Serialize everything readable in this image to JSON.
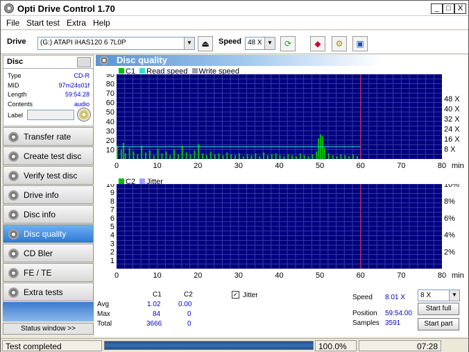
{
  "window": {
    "title": "Opti Drive Control 1.70",
    "min": "_",
    "max": "□",
    "close": "X"
  },
  "menu": [
    "File",
    "Start test",
    "Extra",
    "Help"
  ],
  "toolbar": {
    "drive_label": "Drive",
    "drive_value": "(G:)   ATAPI iHAS120   6 7L0P",
    "speed_label": "Speed",
    "speed_value": "48 X"
  },
  "disc": {
    "header": "Disc",
    "rows": [
      {
        "k": "Type",
        "v": "CD-R"
      },
      {
        "k": "MID",
        "v": "97m24s01f"
      },
      {
        "k": "Length",
        "v": "59:54.28"
      },
      {
        "k": "Contents",
        "v": "audio"
      },
      {
        "k": "Label",
        "v": ""
      }
    ]
  },
  "nav": [
    "Transfer rate",
    "Create test disc",
    "Verify test disc",
    "Drive info",
    "Disc info",
    "Disc quality",
    "CD Bler",
    "FE / TE",
    "Extra tests"
  ],
  "nav_active": 5,
  "status_window": "Status window >>",
  "panel_title": "Disc quality",
  "chart_data": [
    {
      "type": "bar",
      "legend": [
        "C1",
        "Read speed",
        "Write speed"
      ],
      "colors": {
        "c1": "#00c000",
        "read": "#30e0d0",
        "write": "#a0a0a0",
        "bg": "#000080",
        "grid": "#3a3aa0",
        "marker": "#b03060"
      },
      "x_ticks": [
        0,
        10,
        20,
        30,
        40,
        50,
        60,
        70,
        80
      ],
      "x_unit": "min",
      "y_ticks": [
        10,
        20,
        30,
        40,
        50,
        60,
        70,
        80,
        90
      ],
      "y2_ticks": [
        "8 X",
        "16 X",
        "24 X",
        "32 X",
        "40 X",
        "48 X"
      ],
      "xlim": [
        0,
        80
      ],
      "ylim": [
        0,
        90
      ],
      "end_marker": 60,
      "read_speed": {
        "x": [
          0,
          60
        ],
        "y": [
          8,
          8
        ]
      },
      "c1_profile": [
        {
          "x": 0,
          "y": 14
        },
        {
          "x": 1,
          "y": 10
        },
        {
          "x": 1.5,
          "y": 17
        },
        {
          "x": 2,
          "y": 6
        },
        {
          "x": 3,
          "y": 12
        },
        {
          "x": 4,
          "y": 8
        },
        {
          "x": 5,
          "y": 5
        },
        {
          "x": 6,
          "y": 14
        },
        {
          "x": 7,
          "y": 7
        },
        {
          "x": 8,
          "y": 9
        },
        {
          "x": 9,
          "y": 4
        },
        {
          "x": 10,
          "y": 11
        },
        {
          "x": 11,
          "y": 6
        },
        {
          "x": 12,
          "y": 8
        },
        {
          "x": 13,
          "y": 4
        },
        {
          "x": 14,
          "y": 10
        },
        {
          "x": 15,
          "y": 5
        },
        {
          "x": 16,
          "y": 14
        },
        {
          "x": 17,
          "y": 7
        },
        {
          "x": 18,
          "y": 5
        },
        {
          "x": 19,
          "y": 9
        },
        {
          "x": 20,
          "y": 16
        },
        {
          "x": 21,
          "y": 6
        },
        {
          "x": 22,
          "y": 4
        },
        {
          "x": 23,
          "y": 8
        },
        {
          "x": 24,
          "y": 5
        },
        {
          "x": 25,
          "y": 6
        },
        {
          "x": 26,
          "y": 4
        },
        {
          "x": 27,
          "y": 7
        },
        {
          "x": 28,
          "y": 5
        },
        {
          "x": 29,
          "y": 4
        },
        {
          "x": 30,
          "y": 6
        },
        {
          "x": 31,
          "y": 3
        },
        {
          "x": 32,
          "y": 5
        },
        {
          "x": 33,
          "y": 4
        },
        {
          "x": 34,
          "y": 6
        },
        {
          "x": 35,
          "y": 3
        },
        {
          "x": 36,
          "y": 7
        },
        {
          "x": 37,
          "y": 4
        },
        {
          "x": 38,
          "y": 5
        },
        {
          "x": 39,
          "y": 6
        },
        {
          "x": 40,
          "y": 4
        },
        {
          "x": 41,
          "y": 3
        },
        {
          "x": 42,
          "y": 5
        },
        {
          "x": 43,
          "y": 4
        },
        {
          "x": 44,
          "y": 3
        },
        {
          "x": 45,
          "y": 6
        },
        {
          "x": 46,
          "y": 4
        },
        {
          "x": 47,
          "y": 3
        },
        {
          "x": 48,
          "y": 5
        },
        {
          "x": 49,
          "y": 8
        },
        {
          "x": 49.5,
          "y": 22
        },
        {
          "x": 50,
          "y": 26
        },
        {
          "x": 50.5,
          "y": 24
        },
        {
          "x": 51,
          "y": 12
        },
        {
          "x": 52,
          "y": 6
        },
        {
          "x": 53,
          "y": 4
        },
        {
          "x": 54,
          "y": 3
        },
        {
          "x": 55,
          "y": 5
        },
        {
          "x": 56,
          "y": 4
        },
        {
          "x": 57,
          "y": 3
        },
        {
          "x": 58,
          "y": 5
        },
        {
          "x": 59,
          "y": 3
        }
      ]
    },
    {
      "type": "bar",
      "legend": [
        "C2",
        "Jitter"
      ],
      "colors": {
        "c2": "#00c000",
        "jitter": "#a0a0ff",
        "bg": "#000080",
        "grid": "#3a3aa0",
        "marker": "#b03060"
      },
      "x_ticks": [
        0,
        10,
        20,
        30,
        40,
        50,
        60,
        70,
        80
      ],
      "x_unit": "min",
      "y_ticks": [
        1,
        2,
        3,
        4,
        5,
        6,
        7,
        8,
        9,
        10
      ],
      "y2_ticks": [
        "2%",
        "4%",
        "6%",
        "8%",
        "10%"
      ],
      "xlim": [
        0,
        80
      ],
      "ylim": [
        0,
        10
      ],
      "end_marker": 60,
      "values": []
    }
  ],
  "stats": {
    "cols": [
      "C1",
      "C2"
    ],
    "rows": [
      {
        "k": "Avg",
        "c1": "1.02",
        "c2": "0.00"
      },
      {
        "k": "Max",
        "c1": "84",
        "c2": "0"
      },
      {
        "k": "Total",
        "c1": "3666",
        "c2": "0"
      }
    ],
    "jitter_label": "Jitter",
    "speed_label": "Speed",
    "speed_value": "8.01 X",
    "position_label": "Position",
    "position_value": "59:54.00",
    "samples_label": "Samples",
    "samples_value": "3591",
    "speed_select": "8 X",
    "start_full": "Start full",
    "start_part": "Start part"
  },
  "status": {
    "text": "Test completed",
    "progress": 100,
    "percent": "100.0%",
    "time": "07:28"
  }
}
